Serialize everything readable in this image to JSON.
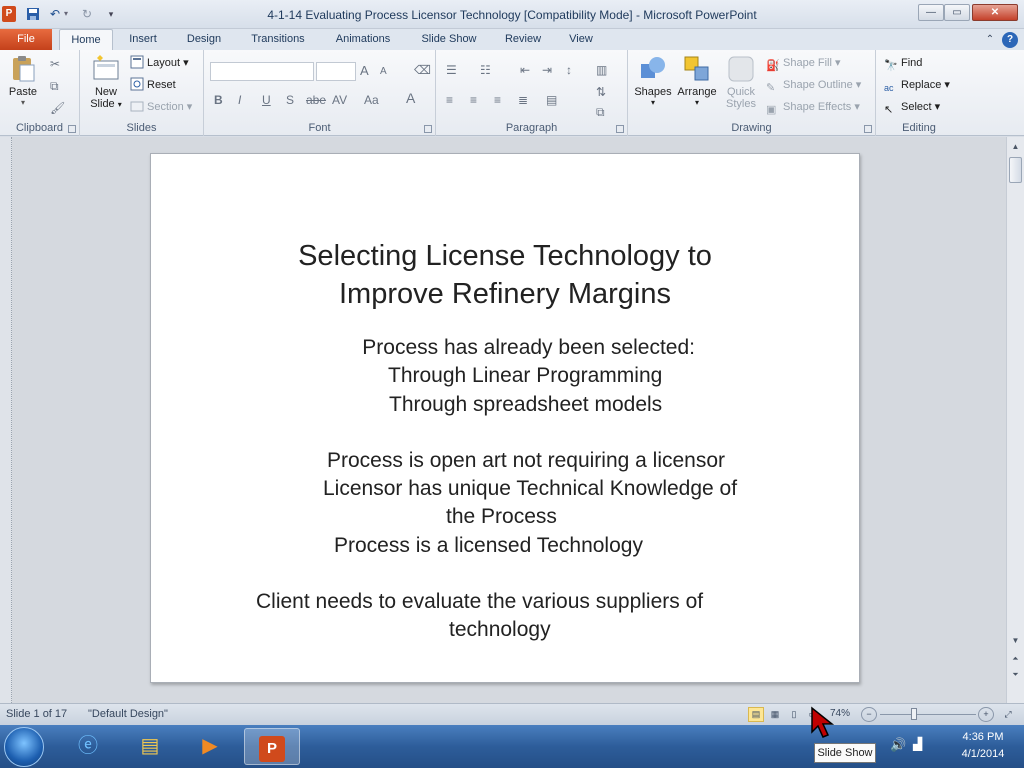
{
  "titlebar": {
    "title": "4-1-14 Evaluating Process Licensor Technology [Compatibility Mode]  -  Microsoft PowerPoint",
    "app_icon_letter": "P",
    "minimize": "—",
    "restore": "▭",
    "close": "✕"
  },
  "tabs": {
    "file": "File",
    "items": [
      "Home",
      "Insert",
      "Design",
      "Transitions",
      "Animations",
      "Slide Show",
      "Review",
      "View"
    ],
    "active": "Home"
  },
  "ribbon": {
    "clipboard": {
      "label": "Clipboard",
      "paste": "Paste"
    },
    "slides": {
      "label": "Slides",
      "new_slide_line1": "New",
      "new_slide_line2": "Slide",
      "layout": "Layout",
      "reset": "Reset",
      "section": "Section"
    },
    "font": {
      "label": "Font",
      "bold": "B",
      "italic": "I",
      "underline": "U",
      "shadow": "S",
      "strike": "abe",
      "spacing": "AV",
      "case": "Aa",
      "grow": "A",
      "shrink": "A",
      "color": "A"
    },
    "paragraph": {
      "label": "Paragraph"
    },
    "drawing": {
      "label": "Drawing",
      "shapes": "Shapes",
      "arrange": "Arrange",
      "quick_styles_line1": "Quick",
      "quick_styles_line2": "Styles",
      "shape_fill": "Shape Fill",
      "shape_outline": "Shape Outline",
      "shape_effects": "Shape Effects"
    },
    "editing": {
      "label": "Editing",
      "find": "Find",
      "replace": "Replace",
      "select": "Select"
    }
  },
  "slide": {
    "title_line1": "Selecting License Technology to",
    "title_line2": "Improve Refinery Margins",
    "line1": "Process has already been selected:",
    "line2": "Through Linear Programming",
    "line3": "Through spreadsheet models",
    "line4": "Process is open art not requiring a licensor",
    "line5": "Licensor has unique Technical Knowledge of",
    "line6": "the Process",
    "line7": "Process is a licensed Technology",
    "line8": "Client needs to evaluate the various suppliers of",
    "line9": "technology"
  },
  "statusbar": {
    "slide_info": "Slide 1 of 17",
    "theme": "\"Default Design\"",
    "zoom": "74%",
    "zoom_level_percent": 74
  },
  "taskbar": {
    "time": "4:36 PM",
    "date": "4/1/2014"
  },
  "tooltip": "Slide Show"
}
